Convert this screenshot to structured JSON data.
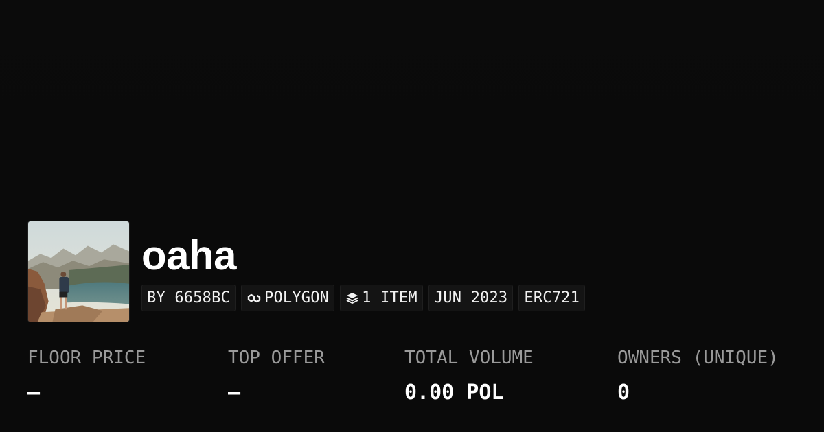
{
  "collection": {
    "name": "oaha",
    "avatar_alt": "collection-avatar"
  },
  "chips": {
    "creator": "BY 6658BC",
    "chain": "POLYGON",
    "items": "1 ITEM",
    "date": "JUN 2023",
    "standard": "ERC721"
  },
  "icons": {
    "chain": "link-icon",
    "items": "layers-icon"
  },
  "stats": {
    "floor_price": {
      "label": "FLOOR PRICE",
      "value": "–"
    },
    "top_offer": {
      "label": "TOP OFFER",
      "value": "–"
    },
    "total_volume": {
      "label": "TOTAL VOLUME",
      "value": "0.00 POL"
    },
    "owners": {
      "label": "OWNERS (UNIQUE)",
      "value": "0"
    }
  },
  "colors": {
    "background": "#0a0a0a",
    "label": "#9a9a9a",
    "chip_bg": "#141414"
  }
}
